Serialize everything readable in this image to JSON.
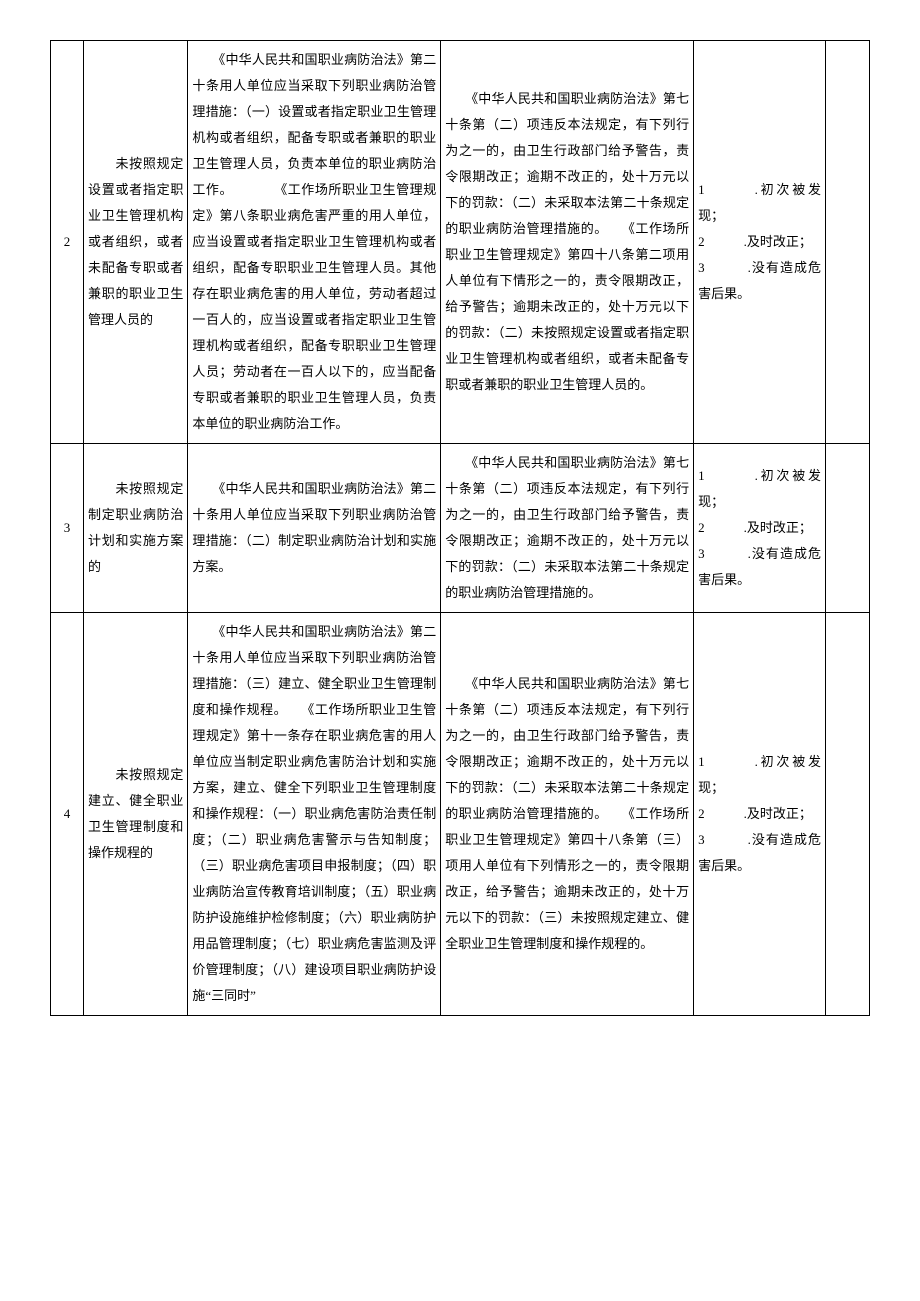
{
  "rows": [
    {
      "idx": "2",
      "violation": "　　未按照规定设置或者指定职业卫生管理机构或者组织，或者未配备专职或者兼职的职业卫生管理人员的",
      "basis": "　　《中华人民共和国职业病防治法》第二十条用人单位应当采取下列职业病防治管理措施：（一）设置或者指定职业卫生管理机构或者组织，配备专职或者兼职的职业卫生管理人员，负责本单位的职业病防治工作。　　　　《工作场所职业卫生管理规定》第八条职业病危害严重的用人单位，应当设置或者指定职业卫生管理机构或者组织，配备专职职业卫生管理人员。其他存在职业病危害的用人单位，劳动者超过一百人的，应当设置或者指定职业卫生管理机构或者组织，配备专职职业卫生管理人员；劳动者在一百人以下的，应当配备专职或者兼职的职业卫生管理人员，负责本单位的职业病防治工作。",
      "penalty": "　　《中华人民共和国职业病防治法》第七十条第（二）项违反本法规定，有下列行为之一的，由卫生行政部门给予警告，责令限期改正；逾期不改正的，处十万元以下的罚款：（二）未采取本法第二十条规定的职业病防治管理措施的。　　《工作场所职业卫生管理规定》第四十八条第二项用人单位有下情形之一的，责令限期改正，给予警告；逾期未改正的，处十万元以下的罚款：（二）未按照规定设置或者指定职业卫生管理机构或者组织，或者未配备专职或者兼职的职业卫生管理人员的。",
      "condition": "1　　　.初次被发现；\n2　　　.及时改正；\n3　　　.没有造成危害后果。",
      "col6": ""
    },
    {
      "idx": "3",
      "violation": "　　未按照规定制定职业病防治计划和实施方案的",
      "basis": "　　《中华人民共和国职业病防治法》第二十条用人单位应当采取下列职业病防治管理措施：（二）制定职业病防治计划和实施方案。",
      "penalty": "　　《中华人民共和国职业病防治法》第七十条第（二）项违反本法规定，有下列行为之一的，由卫生行政部门给予警告，责令限期改正；逾期不改正的，处十万元以下的罚款：（二）未采取本法第二十条规定的职业病防治管理措施的。",
      "condition": "1　　　.初次被发现；\n2　　　.及时改正；\n3　　　.没有造成危害后果。",
      "col6": ""
    },
    {
      "idx": "4",
      "violation": "　　未按照规定建立、健全职业卫生管理制度和操作规程的",
      "basis": "　　《中华人民共和国职业病防治法》第二十条用人单位应当采取下列职业病防治管理措施：（三）建立、健全职业卫生管理制度和操作规程。　　《工作场所职业卫生管理规定》第十一条存在职业病危害的用人单位应当制定职业病危害防治计划和实施方案，建立、健全下列职业卫生管理制度和操作规程：（一）职业病危害防治责任制度；（二）职业病危害警示与告知制度；（三）职业病危害项目申报制度；（四）职业病防治宣传教育培训制度；（五）职业病防护设施维护检修制度；（六）职业病防护用品管理制度；（七）职业病危害监测及评价管理制度；（八）建设项目职业病防护设施“三同时”",
      "penalty": "　　《中华人民共和国职业病防治法》第七十条第（二）项违反本法规定，有下列行为之一的，由卫生行政部门给予警告，责令限期改正；逾期不改正的，处十万元以下的罚款：（二）未采取本法第二十条规定的职业病防治管理措施的。　　《工作场所职业卫生管理规定》第四十八条第（三）项用人单位有下列情形之一的，责令限期改正，给予警告；逾期未改正的，处十万元以下的罚款：（三）未按照规定建立、健全职业卫生管理制度和操作规程的。",
      "condition": "1　　　.初次被发现；\n2　　　.及时改正；\n3　　　.没有造成危害后果。",
      "col6": ""
    }
  ]
}
